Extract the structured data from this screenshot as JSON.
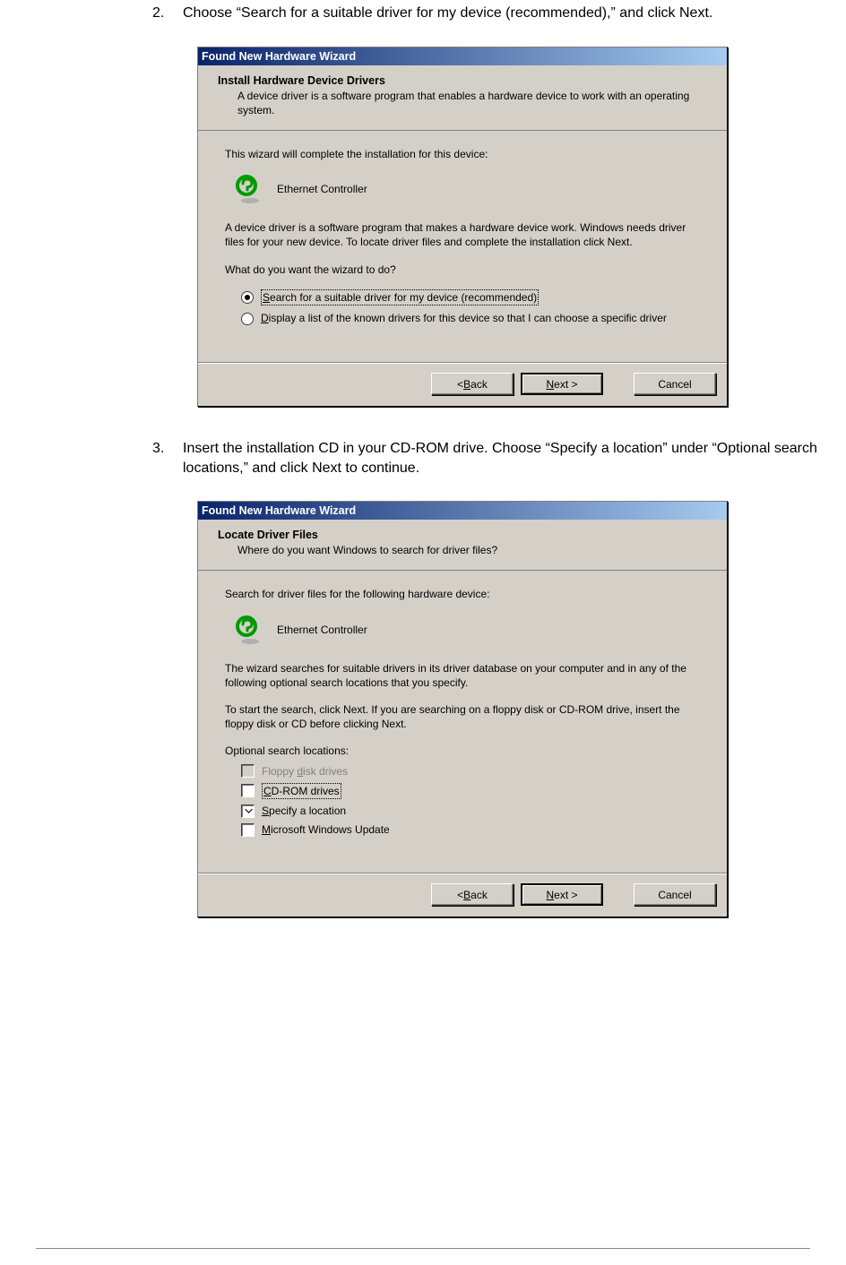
{
  "steps": {
    "s2": {
      "num": "2.",
      "text": "Choose “Search for a suitable driver for my device (recommended),” and click Next."
    },
    "s3": {
      "num": "3.",
      "text": "Insert the installation CD in your CD-ROM drive. Choose “Specify a location” under “Optional search locations,” and click Next to continue."
    }
  },
  "win1": {
    "title": "Found New Hardware Wizard",
    "hdr_title": "Install Hardware Device Drivers",
    "hdr_sub": "A device driver is a software program that enables a hardware device to work with an operating system.",
    "body1": "This wizard will complete the installation for this device:",
    "device": "Ethernet Controller",
    "body2": "A device driver is a software program that makes a hardware device work. Windows needs driver files for your new device. To locate driver files and complete the installation click Next.",
    "prompt": "What do you want the wizard to do?",
    "radio1_pre": "S",
    "radio1_rest": "earch for a suitable driver for my device (recommended)",
    "radio2_pre": "D",
    "radio2_rest": "isplay a list of the known drivers for this device so that I can choose a specific driver",
    "btn_back_pre": "< ",
    "btn_back_u": "B",
    "btn_back_rest": "ack",
    "btn_next_u": "N",
    "btn_next_rest": "ext >",
    "btn_cancel": "Cancel"
  },
  "win2": {
    "title": "Found New Hardware Wizard",
    "hdr_title": "Locate Driver Files",
    "hdr_sub": "Where do you want Windows to search for driver files?",
    "body1": "Search for driver files for the following hardware device:",
    "device": "Ethernet Controller",
    "body2": "The wizard searches for suitable drivers in its driver database on your computer and in any of the following optional search locations that you specify.",
    "body3": "To start the search, click Next. If you are searching on a floppy disk or CD-ROM drive, insert the floppy disk or CD before clicking Next.",
    "opt_title": "Optional search locations:",
    "cb1_pre": "Floppy ",
    "cb1_u": "d",
    "cb1_rest": "isk drives",
    "cb2_pre": "",
    "cb2_u": "C",
    "cb2_rest": "D-ROM drives",
    "cb3_pre": "",
    "cb3_u": "S",
    "cb3_rest": "pecify a location",
    "cb4_pre": "",
    "cb4_u": "M",
    "cb4_rest": "icrosoft Windows Update",
    "btn_back_pre": "< ",
    "btn_back_u": "B",
    "btn_back_rest": "ack",
    "btn_next_u": "N",
    "btn_next_rest": "ext >",
    "btn_cancel": "Cancel"
  }
}
